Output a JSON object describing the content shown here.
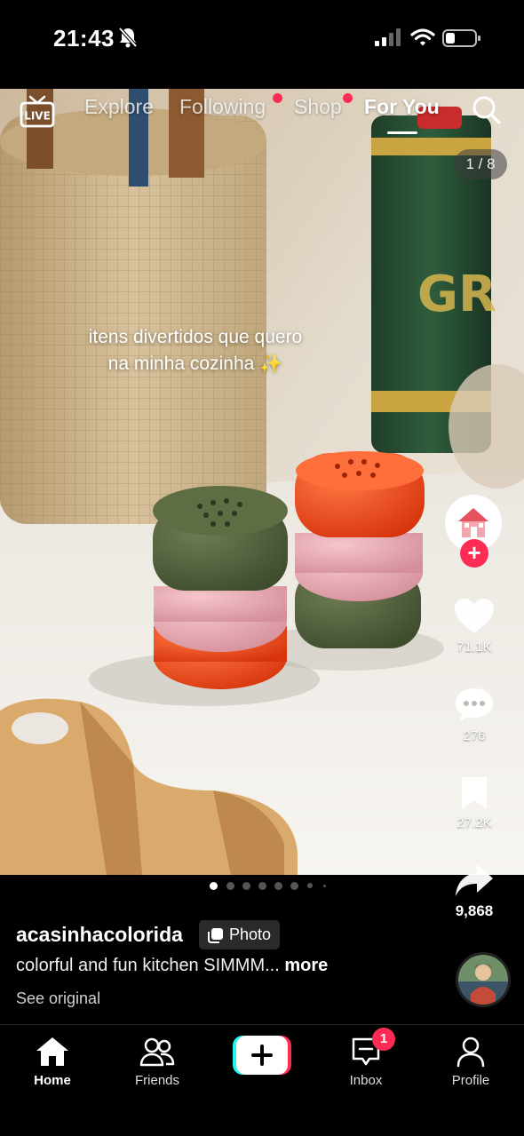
{
  "status_bar": {
    "time": "21:43"
  },
  "top_nav": {
    "live_label": "LIVE",
    "tabs": [
      {
        "label": "Explore",
        "active": false,
        "has_dot": false
      },
      {
        "label": "Following",
        "active": false,
        "has_dot": true
      },
      {
        "label": "Shop",
        "active": false,
        "has_dot": true
      },
      {
        "label": "For You",
        "active": true,
        "has_dot": false
      }
    ]
  },
  "post": {
    "page_counter": "1 / 8",
    "overlay_caption": "itens divertidos que quero\nna minha cozinha ✨",
    "author": "acasinhacolorida",
    "content_type": "Photo",
    "description": "colorful and fun kitchen SIMMM...",
    "more_label": "more",
    "see_original": "See original",
    "carousel_current": 1,
    "likes": "71.1K",
    "comments": "276",
    "saves": "27.2K",
    "shares": "9,868"
  },
  "bottom_nav": {
    "tabs": [
      {
        "label": "Home",
        "active": true
      },
      {
        "label": "Friends",
        "active": false
      },
      {
        "label": "",
        "active": false
      },
      {
        "label": "Inbox",
        "active": false
      },
      {
        "label": "Profile",
        "active": false
      }
    ],
    "inbox_badge": "1"
  },
  "colors": {
    "accent": "#fe2c55",
    "tiktok_cyan": "#25f4ee"
  }
}
